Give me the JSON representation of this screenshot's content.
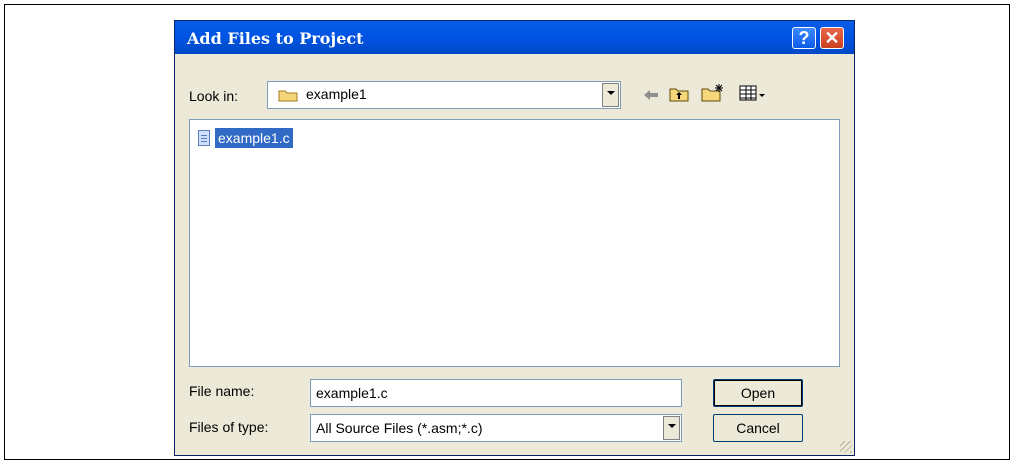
{
  "dialog": {
    "title": "Add Files to Project",
    "help_icon": "question-mark-icon",
    "close_icon": "close-x-icon"
  },
  "look_in": {
    "label": "Look in:",
    "value": "example1",
    "folder_icon": "folder-icon"
  },
  "toolbar": {
    "back_icon": "back-arrow-icon",
    "up_icon": "up-folder-icon",
    "new_folder_icon": "new-folder-icon",
    "view_icon": "view-menu-icon"
  },
  "files": [
    {
      "name": "example1.c",
      "icon": "c-file-icon",
      "selected": true
    }
  ],
  "file_name": {
    "label": "File name:",
    "value": "example1.c"
  },
  "file_type": {
    "label": "Files of type:",
    "value": "All Source Files (*.asm;*.c)"
  },
  "buttons": {
    "open": "Open",
    "cancel": "Cancel"
  }
}
